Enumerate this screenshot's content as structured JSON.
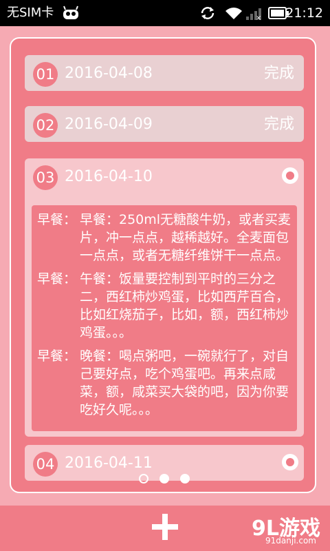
{
  "status_bar": {
    "carrier": "无SIM卡",
    "time": "21:12"
  },
  "diary": {
    "items": [
      {
        "number": "01",
        "date": "2016-04-08",
        "status": "完成"
      },
      {
        "number": "02",
        "date": "2016-04-09",
        "status": "完成"
      },
      {
        "number": "03",
        "date": "2016-04-10",
        "meals": [
          {
            "label": "早餐：",
            "text": "早餐：250ml无糖酸牛奶，或者买麦片，冲一点点，越稀越好。全麦面包一点点，或者无糖纤维饼干一点点。"
          },
          {
            "label": "早餐：",
            "text": "午餐：饭量要控制到平时的三分之二，西红柿炒鸡蛋，比如西芹百合，比如红烧茄子，比如，额，西红柿炒鸡蛋。。。"
          },
          {
            "label": "早餐：",
            "text": "晚餐：喝点粥吧，一碗就行了，对自己要好点，吃个鸡蛋吧。再来点咸菜，额，咸菜买大袋的吧，因为你要吃好久呢。。。"
          }
        ]
      },
      {
        "number": "04",
        "date": "2016-04-11"
      }
    ]
  },
  "pager": {
    "count": 3,
    "active_index": 0
  },
  "bottom_bar": {
    "watermark_main": "9L游戏",
    "watermark_sub": "91danji.com"
  },
  "colors": {
    "accent": "#f07c87",
    "background": "#f6aab3",
    "done_item": "#e9d0d2"
  }
}
